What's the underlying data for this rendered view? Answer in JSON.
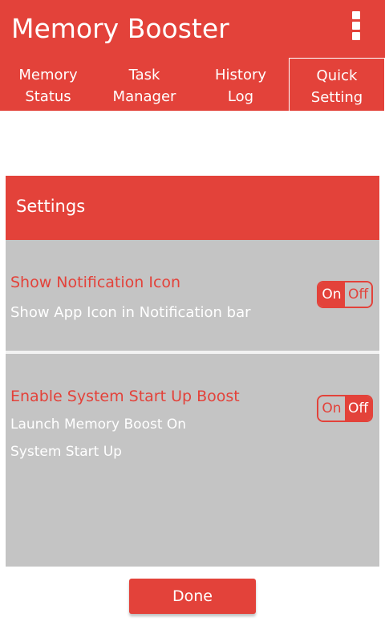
{
  "colors": {
    "primary": "#e3423a",
    "panel": "#c4c4c4",
    "text_on_primary": "#ffffff"
  },
  "appbar": {
    "title": "Memory Booster",
    "menu_icon": "overflow-menu-icon"
  },
  "tabs": [
    {
      "line1": "Memory",
      "line2": "Status",
      "active": false
    },
    {
      "line1": "Task",
      "line2": "Manager",
      "active": false
    },
    {
      "line1": "History",
      "line2": "Log",
      "active": false
    },
    {
      "line1": "Quick",
      "line2": "Setting",
      "active": true
    }
  ],
  "settings": {
    "header": "Settings",
    "items": [
      {
        "title": "Show Notification Icon",
        "description": "Show App Icon in Notification bar",
        "toggle": {
          "on_label": "On",
          "off_label": "Off",
          "value": "On"
        }
      },
      {
        "title": "Enable System Start Up Boost",
        "description_line1": "Launch Memory Boost On",
        "description_line2": "System Start Up",
        "toggle": {
          "on_label": "On",
          "off_label": "Off",
          "value": "Off"
        }
      }
    ]
  },
  "footer": {
    "done_label": "Done"
  }
}
